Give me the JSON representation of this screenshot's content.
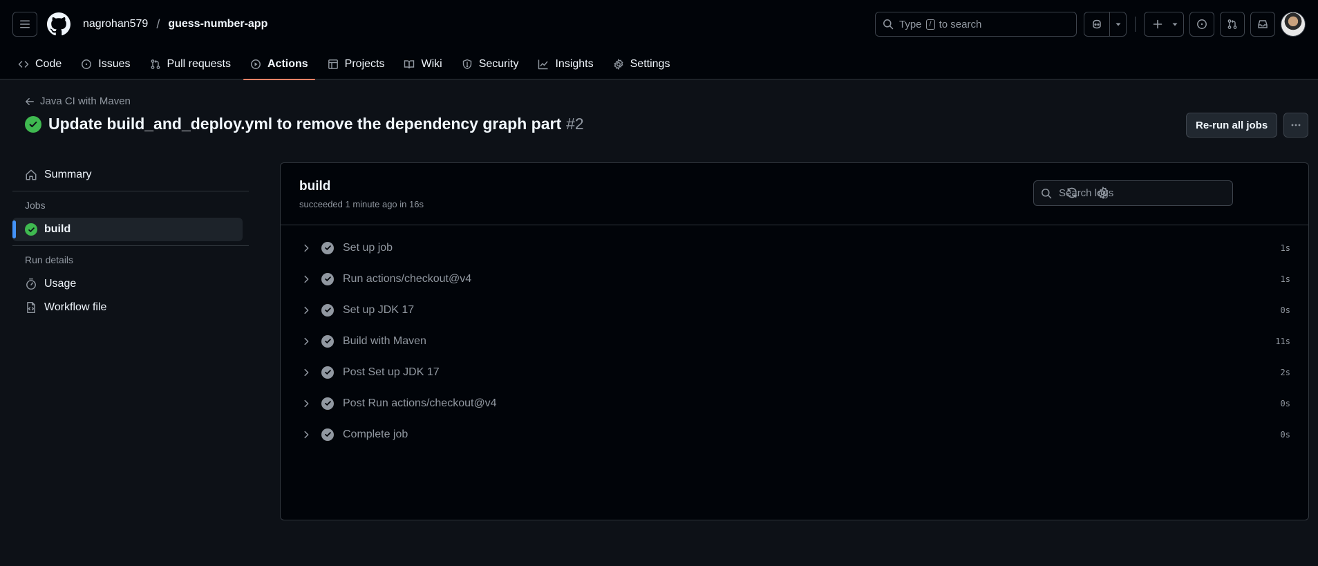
{
  "header": {
    "owner": "nagrohan579",
    "separator": "/",
    "repo": "guess-number-app",
    "search": {
      "prefix": "Type",
      "key": "/",
      "suffix": "to search"
    }
  },
  "nav": {
    "tabs": [
      {
        "label": "Code",
        "icon": "code-icon"
      },
      {
        "label": "Issues",
        "icon": "issue-icon"
      },
      {
        "label": "Pull requests",
        "icon": "pull-request-icon"
      },
      {
        "label": "Actions",
        "icon": "play-icon",
        "active": true
      },
      {
        "label": "Projects",
        "icon": "table-icon"
      },
      {
        "label": "Wiki",
        "icon": "book-icon"
      },
      {
        "label": "Security",
        "icon": "shield-icon"
      },
      {
        "label": "Insights",
        "icon": "graph-icon"
      },
      {
        "label": "Settings",
        "icon": "gear-icon"
      }
    ]
  },
  "run": {
    "workflow": "Java CI with Maven",
    "title": "Update build_and_deploy.yml to remove the dependency graph part",
    "number": "#2",
    "rerun_label": "Re-run all jobs"
  },
  "sidebar": {
    "summary": "Summary",
    "jobs_heading": "Jobs",
    "job": "build",
    "details_heading": "Run details",
    "usage": "Usage",
    "workflow_file": "Workflow file"
  },
  "job": {
    "name": "build",
    "status": "succeeded 1 minute ago in 16s",
    "search_placeholder": "Search logs",
    "steps": [
      {
        "name": "Set up job",
        "duration": "1s"
      },
      {
        "name": "Run actions/checkout@v4",
        "duration": "1s"
      },
      {
        "name": "Set up JDK 17",
        "duration": "0s"
      },
      {
        "name": "Build with Maven",
        "duration": "11s"
      },
      {
        "name": "Post Set up JDK 17",
        "duration": "2s"
      },
      {
        "name": "Post Run actions/checkout@v4",
        "duration": "0s"
      },
      {
        "name": "Complete job",
        "duration": "0s"
      }
    ]
  },
  "colors": {
    "background": "#0d1117",
    "success": "#3fb950",
    "active_tab_underline": "#f78166",
    "selected_marker": "#4493f8"
  }
}
